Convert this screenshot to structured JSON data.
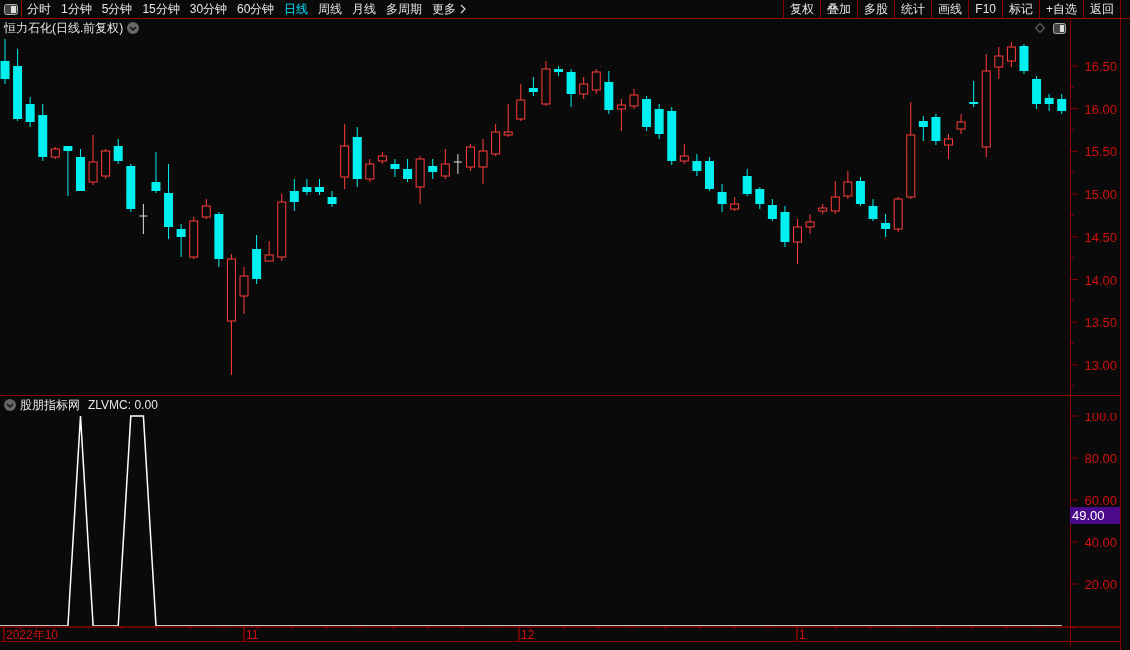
{
  "toolbar": {
    "periods": [
      {
        "label": "分时",
        "selected": false
      },
      {
        "label": "1分钟",
        "selected": false
      },
      {
        "label": "5分钟",
        "selected": false
      },
      {
        "label": "15分钟",
        "selected": false
      },
      {
        "label": "30分钟",
        "selected": false
      },
      {
        "label": "60分钟",
        "selected": false
      },
      {
        "label": "日线",
        "selected": true
      },
      {
        "label": "周线",
        "selected": false
      },
      {
        "label": "月线",
        "selected": false
      },
      {
        "label": "多周期",
        "selected": false
      }
    ],
    "more": "更多",
    "buttons": [
      "复权",
      "叠加",
      "多股",
      "统计",
      "画线",
      "F10",
      "标记",
      "+自选",
      "返回"
    ]
  },
  "price_chart": {
    "title": "恒力石化(日线.前复权)",
    "y_axis_labels": [
      "16.50",
      "16.00",
      "15.50",
      "15.00",
      "14.50",
      "14.00",
      "13.50",
      "13.00"
    ]
  },
  "indicator": {
    "title": "股朋指标网",
    "legend_reading": ": 0.00",
    "cursor_value": "49.00",
    "chart_data": {
      "type": "line",
      "grid": true,
      "ylim": [
        0,
        100
      ],
      "yticks": [
        {
          "value": 20,
          "label": "20.00"
        },
        {
          "value": 40,
          "label": "40.00"
        },
        {
          "value": 60,
          "label": "60.00"
        },
        {
          "value": 80,
          "label": "80.00"
        },
        {
          "value": 100,
          "label": "100.0"
        }
      ],
      "series": [
        {
          "name": "ZLVMC",
          "color": "#ffffff",
          "values": [
            0,
            0,
            0,
            0,
            0,
            0,
            100,
            0,
            0,
            0,
            100,
            100,
            0,
            0,
            0,
            0,
            0,
            0,
            0,
            0,
            0,
            0,
            0,
            0,
            0,
            0,
            0,
            0,
            0,
            0,
            0,
            0,
            0,
            0,
            0,
            0,
            0,
            0,
            0,
            0,
            0,
            0,
            0,
            0,
            0,
            0,
            0,
            0,
            0,
            0,
            0,
            0,
            0,
            0,
            0,
            0,
            0,
            0,
            0,
            0,
            0,
            0,
            0,
            0,
            0,
            0,
            0,
            0,
            0,
            0,
            0,
            0,
            0,
            0,
            0,
            0,
            0,
            0,
            0,
            0,
            0,
            0,
            0,
            0,
            0
          ]
        }
      ]
    }
  },
  "date_axis": {
    "labels": [
      "2022年10",
      "11",
      "12",
      "1"
    ]
  }
}
